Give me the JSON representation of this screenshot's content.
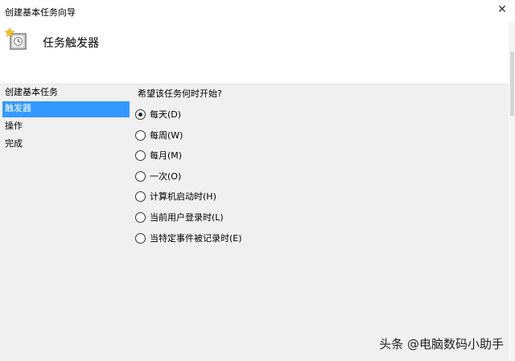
{
  "window": {
    "title": "创建基本任务向导",
    "close_glyph": "✕"
  },
  "header": {
    "title": "任务触发器",
    "icon": "clock-trigger-icon"
  },
  "nav": {
    "items": [
      {
        "label": "创建基本任务",
        "selected": false
      },
      {
        "label": "触发器",
        "selected": true
      },
      {
        "label": "操作",
        "selected": false
      },
      {
        "label": "完成",
        "selected": false
      }
    ]
  },
  "main": {
    "question": "希望该任务何时开始?",
    "options": [
      {
        "label": "每天(D)",
        "checked": true
      },
      {
        "label": "每周(W)",
        "checked": false
      },
      {
        "label": "每月(M)",
        "checked": false
      },
      {
        "label": "一次(O)",
        "checked": false
      },
      {
        "label": "计算机启动时(H)",
        "checked": false
      },
      {
        "label": "当前用户登录时(L)",
        "checked": false
      },
      {
        "label": "当特定事件被记录时(E)",
        "checked": false
      }
    ]
  },
  "watermark": "头条 @电脑数码小助手",
  "colors": {
    "selection": "#3399ff",
    "header_bg": "#ffffff",
    "body_bg": "#f0f0f0"
  }
}
